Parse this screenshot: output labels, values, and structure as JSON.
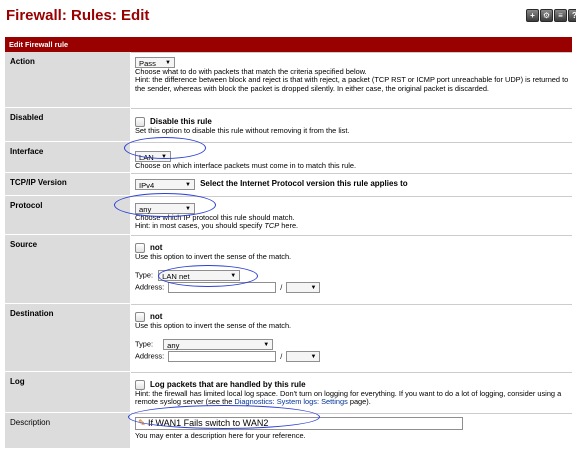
{
  "page": {
    "title": "Firewall: Rules: Edit",
    "icons": [
      {
        "name": "add-icon",
        "glyph": "+"
      },
      {
        "name": "gear-icon",
        "glyph": "⚙"
      },
      {
        "name": "document-icon",
        "glyph": "≡"
      },
      {
        "name": "help-icon",
        "glyph": "?"
      }
    ]
  },
  "panel": {
    "header": "Edit Firewall rule"
  },
  "action": {
    "label": "Action",
    "value": "Pass",
    "help1": "Choose what to do with packets that match the criteria specified below.",
    "help2": "Hint: the difference between block and reject is that with reject, a packet (TCP RST or ICMP port unreachable for UDP) is returned to the sender, whereas with block the packet is dropped silently. In either case, the original packet is discarded."
  },
  "disabled": {
    "label": "Disabled",
    "checkbox_label": "Disable this rule",
    "help": "Set this option to disable this rule without removing it from the list."
  },
  "interface": {
    "label": "Interface",
    "value": "LAN",
    "help": "Choose on which interface packets must come in to match this rule."
  },
  "tcpip_version": {
    "label": "TCP/IP Version",
    "value": "IPv4",
    "help": "Select the Internet Protocol version this rule applies to"
  },
  "protocol": {
    "label": "Protocol",
    "value": "any",
    "help1": "Choose which IP protocol this rule should match.",
    "help2_prefix": "Hint: in most cases, you should specify ",
    "help2_em": "TCP",
    "help2_suffix": "  here."
  },
  "source": {
    "label": "Source",
    "not_label": "not",
    "help": "Use this option to invert the sense of the match.",
    "type_label": "Type:",
    "type_value": "LAN net",
    "address_label": "Address:",
    "slash": "/"
  },
  "destination": {
    "label": "Destination",
    "not_label": "not",
    "help": "Use this option to invert the sense of the match.",
    "type_label": "Type:",
    "type_value": "any",
    "address_label": "Address:",
    "slash": "/"
  },
  "log": {
    "label": "Log",
    "checkbox_label": "Log packets that are handled by this rule",
    "help_prefix": "Hint: the firewall has limited local log space. Don't turn on logging for everything. If you want to do a lot of logging, consider using a remote syslog server (see the ",
    "help_link": "Diagnostics: System logs: Settings",
    "help_suffix": " page)."
  },
  "description": {
    "label": "Description",
    "value": "If WAN1 Fails switch to WAN2",
    "help": "You may enter a description here for your reference."
  },
  "colors": {
    "brand": "#990000",
    "label_bg": "#dcdcdc",
    "annotation_ring": "#2b3fd6",
    "link": "#003399"
  }
}
